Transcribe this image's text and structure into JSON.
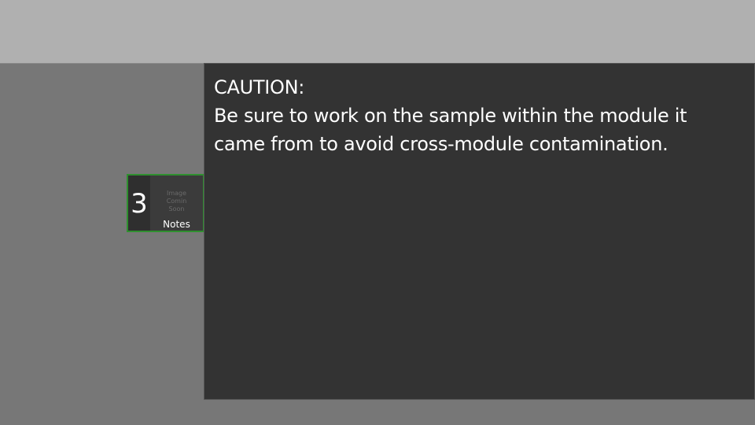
{
  "slide_thumbnail": {
    "number": "3",
    "placeholder_lines": [
      "Image",
      "Comin",
      "Soon"
    ],
    "label": "Notes",
    "border_color": "#2f8f2f"
  },
  "content": {
    "heading": "CAUTION:",
    "line1": "Be sure to work on the sample within the module it",
    "line2": "came from to avoid cross-module contamination."
  },
  "colors": {
    "top_bar": "#b0b0b0",
    "background": "#777777",
    "panel": "#333333",
    "text": "#ffffff"
  }
}
